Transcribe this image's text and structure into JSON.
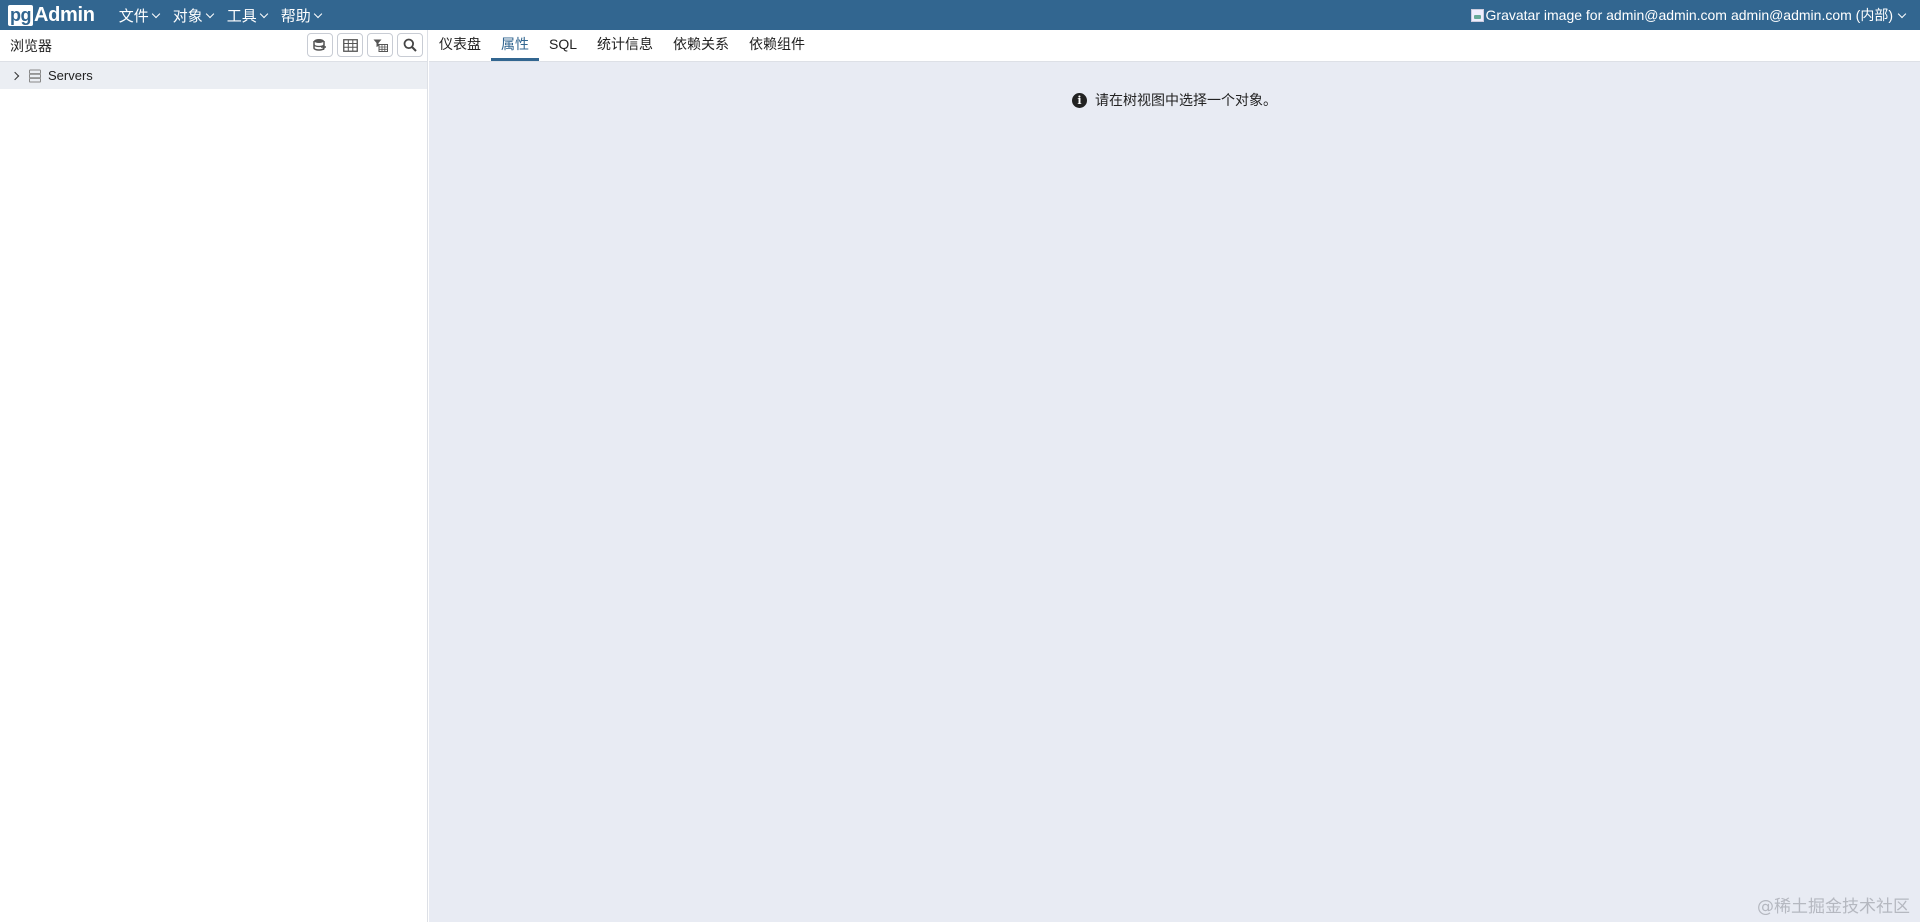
{
  "brand": {
    "pg": "pg",
    "admin": "Admin"
  },
  "menu": [
    {
      "label": "文件"
    },
    {
      "label": "对象"
    },
    {
      "label": "工具"
    },
    {
      "label": "帮助"
    }
  ],
  "user": {
    "gravatar_alt": "Gravatar image for admin@admin.com",
    "name": "admin@admin.com (内部)"
  },
  "browser": {
    "title": "浏览器",
    "toolbar": [
      "query-tool-icon",
      "view-data-icon",
      "filtered-rows-icon",
      "search-icon"
    ],
    "tree": [
      {
        "label": "Servers",
        "icon": "servers-icon"
      }
    ]
  },
  "tabs": [
    {
      "label": "仪表盘",
      "active": false
    },
    {
      "label": "属性",
      "active": true
    },
    {
      "label": "SQL",
      "active": false
    },
    {
      "label": "统计信息",
      "active": false
    },
    {
      "label": "依赖关系",
      "active": false
    },
    {
      "label": "依赖组件",
      "active": false
    }
  ],
  "main": {
    "message": "请在树视图中选择一个对象。"
  },
  "watermark": "@稀土掘金技术社区",
  "colors": {
    "navbar": "#326690",
    "content_bg": "#e8ebf3",
    "active_tab": "#326690"
  }
}
